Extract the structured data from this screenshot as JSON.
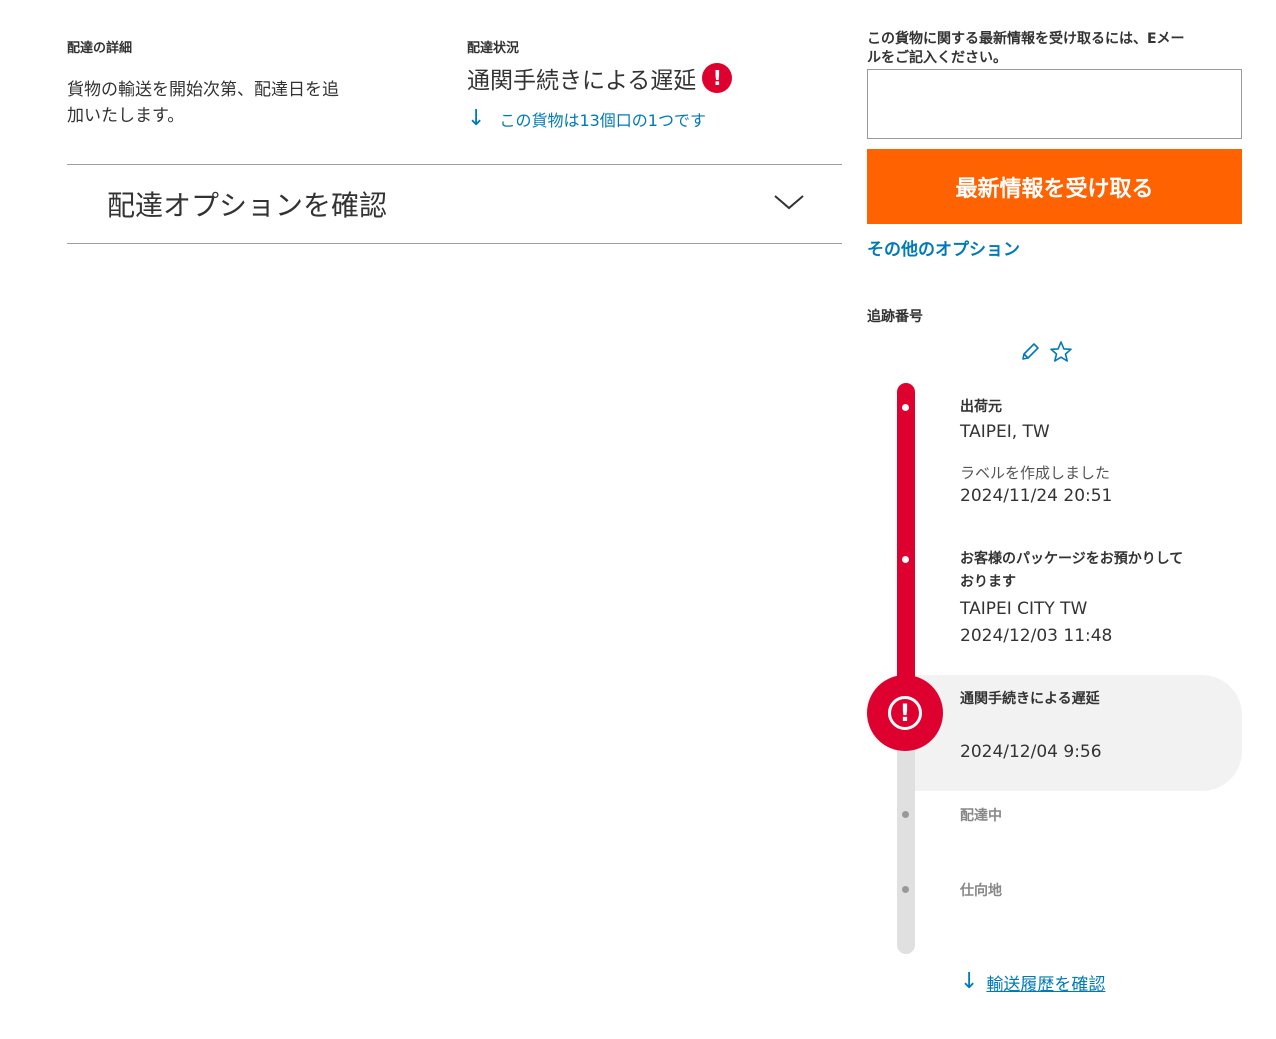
{
  "delivery_details": {
    "label": "配達の詳細",
    "text_line1": "貨物の輸送を開始次第、配達日を追",
    "text_line2": "加いたします。"
  },
  "delivery_status": {
    "label": "配達状況",
    "status": "通関手続きによる遅延",
    "alert_glyph": "!",
    "piece_link": "この貨物は13個口の1つです",
    "arrow_glyph": "↓"
  },
  "delivery_options": {
    "title": "配達オプションを確認"
  },
  "email_updates": {
    "label_line1": "この貨物に関する最新情報を受け取るには、Eメー",
    "label_line2": "ルをご記入ください。",
    "value": "",
    "button_label": "最新情報を受け取る",
    "more_options": "その他のオプション"
  },
  "tracking": {
    "label": "追跡番号",
    "icons": [
      "pencil-icon",
      "star-icon"
    ]
  },
  "timeline": {
    "events": [
      {
        "title": "出荷元",
        "location": "TAIPEI, TW",
        "description": "ラベルを作成しました",
        "datetime": "2024/11/24 20:51"
      },
      {
        "title_line1": "お客様のパッケージをお預かりして",
        "title_line2": "おります",
        "location": "TAIPEI CITY TW",
        "datetime": "2024/12/03 11:48"
      },
      {
        "title": "通関手続きによる遅延",
        "datetime": "2024/12/04 9:56",
        "alert_glyph": "!"
      },
      {
        "title": "配達中"
      },
      {
        "title": "仕向地"
      }
    ],
    "history_link": "輸送履歴を確認",
    "arrow_glyph": "↓"
  },
  "colors": {
    "accent_red": "#de002e",
    "cta_orange": "#ff6200",
    "link_blue": "#007ab7"
  }
}
